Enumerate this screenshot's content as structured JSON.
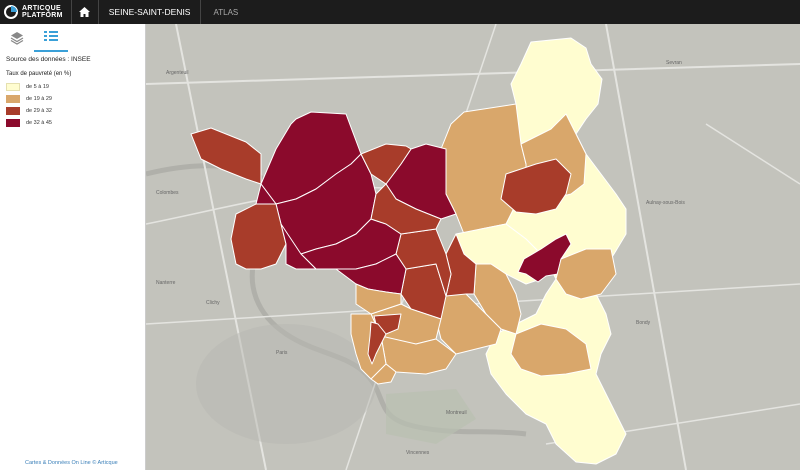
{
  "topbar": {
    "logo_line1": "ARTICQUE",
    "logo_line2": "PLATFORM",
    "home_icon": "home-icon",
    "title": "SEINE-SAINT-DENIS",
    "atlas": "ATLAS"
  },
  "sidebar": {
    "tabs": [
      {
        "icon": "layers-icon"
      },
      {
        "icon": "legend-list-icon",
        "active": true
      }
    ],
    "source": "Source des données : INSEE",
    "legend_title": "Taux de pauvreté (en %)",
    "legend": [
      {
        "label": "de 5 à 19",
        "color": "#fffdd0"
      },
      {
        "label": "de 19 à 29",
        "color": "#d9a76b"
      },
      {
        "label": "de 29 à 32",
        "color": "#a83c2a"
      },
      {
        "label": "de 32 à 45",
        "color": "#8b0a2c"
      }
    ],
    "credits": "Cartes & Données On Line © Articque"
  },
  "map": {
    "basemap_labels": [
      "Paris",
      "Argenteuil",
      "Sevran",
      "Montreuil",
      "Bondy",
      "Aulnay-sous-Bois",
      "Vincennes",
      "Colombes",
      "Nanterre",
      "Clichy"
    ],
    "colors": {
      "basemap": "#c6c6c0",
      "basemap_dark": "#b5b5b0",
      "road": "#e8e8e4",
      "border": "#ffffff"
    }
  }
}
